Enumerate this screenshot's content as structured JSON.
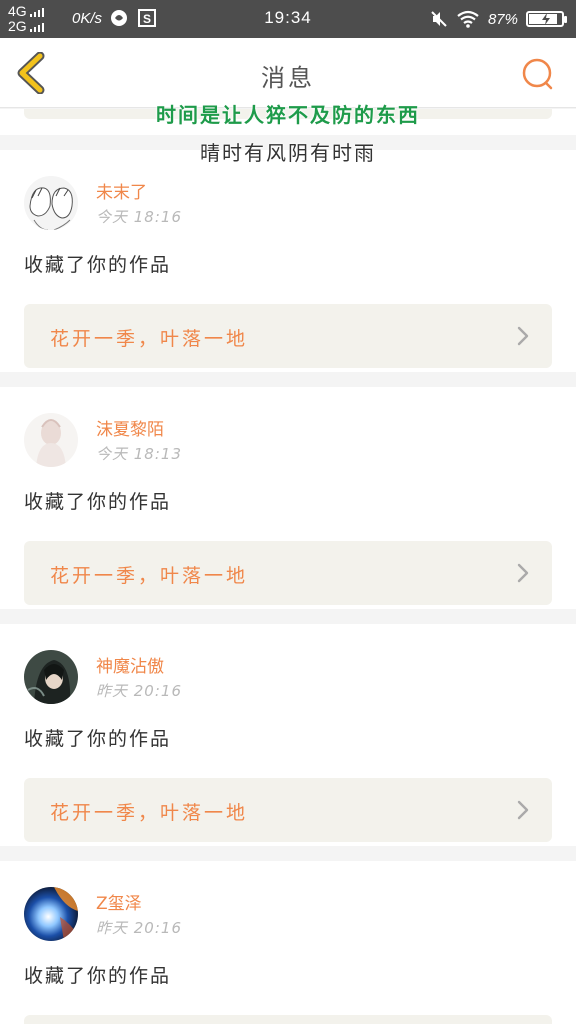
{
  "status_bar": {
    "network_top": "4G",
    "network_bottom": "2G",
    "speed": "0K/s",
    "time": "19:34",
    "battery": "87%",
    "battery_level": 0.87
  },
  "header": {
    "title": "消息",
    "back_icon": "chevron-left-icon",
    "search_icon": "search-icon"
  },
  "overlay": {
    "line1": "时间是让人猝不及防的东西",
    "line2": "晴时有风阴有时雨"
  },
  "colors": {
    "accent": "#f0874a",
    "back_arrow": "#f2c21c",
    "lyric_green": "#1e9b4a",
    "status_bar": "#4d4d4d",
    "card_box": "#f3f2ec"
  },
  "messages": [
    {
      "user": "未末了",
      "time": "今天 18:16",
      "action": "收藏了你的作品",
      "work": "花开一季，叶落一地"
    },
    {
      "user": "沫夏黎陌",
      "time": "今天 18:13",
      "action": "收藏了你的作品",
      "work": "花开一季，叶落一地"
    },
    {
      "user": "神魔沾傲",
      "time": "昨天 20:16",
      "action": "收藏了你的作品",
      "work": "花开一季，叶落一地"
    },
    {
      "user": "Z玺泽",
      "time": "昨天 20:16",
      "action": "收藏了你的作品",
      "work": ""
    }
  ]
}
